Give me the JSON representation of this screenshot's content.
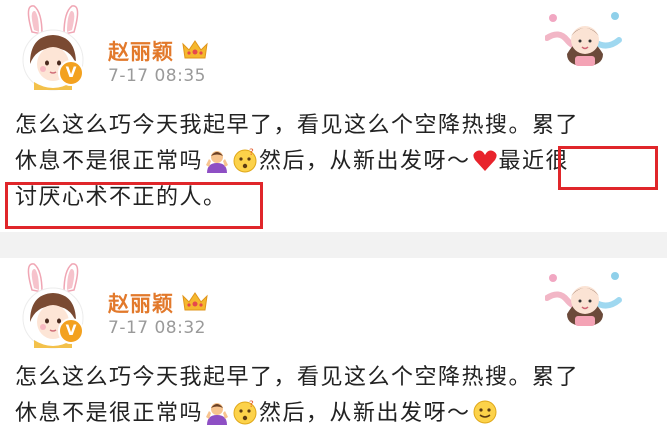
{
  "posts": [
    {
      "username": "赵丽颖",
      "time": "7-17 08:35",
      "line1": "怎么这么巧今天我起早了，看见这么个空降热搜。累了",
      "line2_a": "休息不是很正常吗",
      "line2_b": "然后，从新出发呀～",
      "line2_c": "最近很",
      "line3": "讨厌心术不正的人。"
    },
    {
      "username": "赵丽颖",
      "time": "7-17 08:32",
      "line1": "怎么这么巧今天我起早了，看见这么个空降热搜。累了",
      "line2_a": "休息不是很正常吗",
      "line2_b": "然后，从新出发呀～"
    }
  ],
  "icons": [
    "bunny-avatar-icon",
    "verified-badge-icon",
    "crown-icon",
    "decoration-icon",
    "shrug-emoji-icon",
    "thinking-emoji-icon",
    "heart-emoji-icon",
    "smile-emoji-icon"
  ],
  "colors": {
    "username": "#e2792b",
    "highlight": "#e0262a",
    "separator": "#f2f2f2"
  }
}
